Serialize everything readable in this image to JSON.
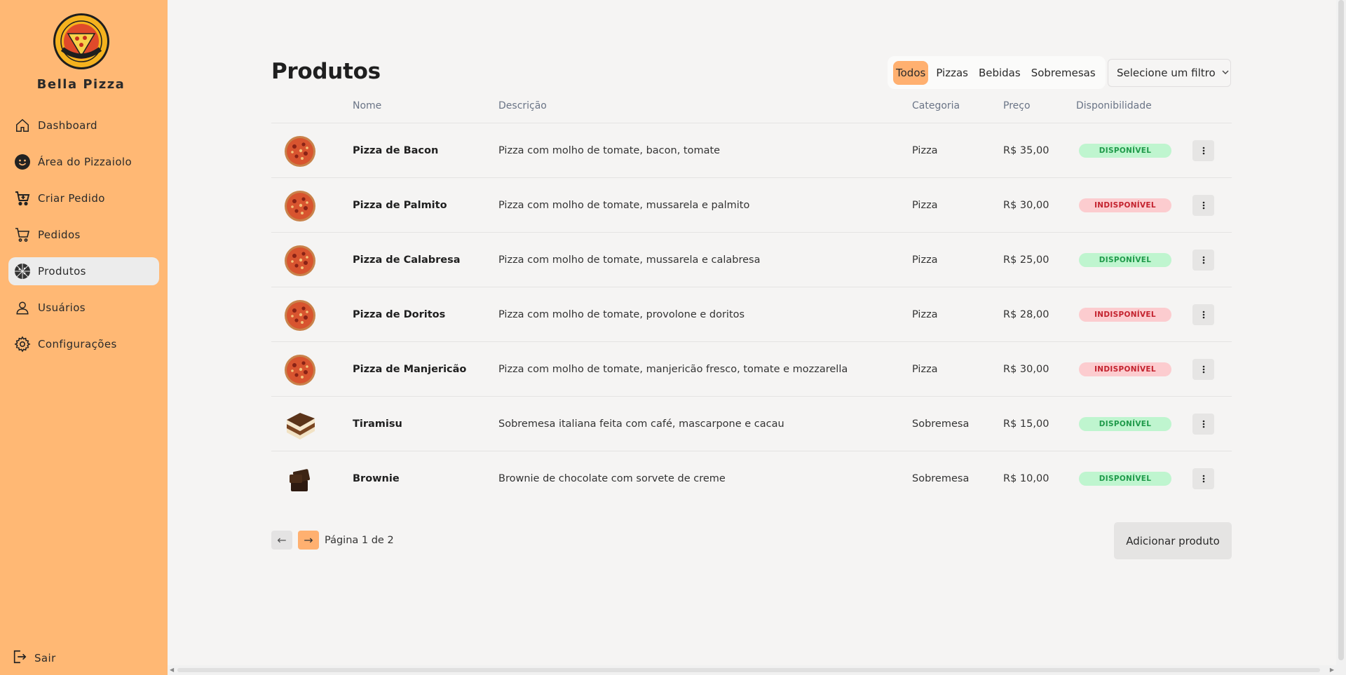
{
  "sidebar": {
    "brand": "Bella Pizza",
    "items": [
      {
        "label": "Dashboard",
        "icon": "home-icon",
        "active": false
      },
      {
        "label": "Área do Pizzaiolo",
        "icon": "smiley-icon",
        "active": false
      },
      {
        "label": "Criar Pedido",
        "icon": "cart-plus-icon",
        "active": false
      },
      {
        "label": "Pedidos",
        "icon": "cart-icon",
        "active": false
      },
      {
        "label": "Produtos",
        "icon": "pizza-icon",
        "active": true
      },
      {
        "label": "Usuários",
        "icon": "user-icon",
        "active": false
      },
      {
        "label": "Configurações",
        "icon": "gear-icon",
        "active": false
      }
    ],
    "logout_label": "Sair"
  },
  "main": {
    "title": "Produtos",
    "segments": [
      "Todos",
      "Pizzas",
      "Bebidas",
      "Sobremesas"
    ],
    "active_segment": "Todos",
    "filter_placeholder": "Selecione um filtro",
    "columns": [
      "Nome",
      "Descrição",
      "Categoria",
      "Preço",
      "Disponibilidade"
    ],
    "rows": [
      {
        "name": "Pizza de Bacon",
        "description": "Pizza com molho de tomate, bacon, tomate",
        "category": "Pizza",
        "price": "R$ 35,00",
        "status": "DISPONÍVEL",
        "available": true,
        "image": "pizza"
      },
      {
        "name": "Pizza de Palmito",
        "description": "Pizza com molho de tomate, mussarela e palmito",
        "category": "Pizza",
        "price": "R$ 30,00",
        "status": "INDISPONÍVEL",
        "available": false,
        "image": "pizza"
      },
      {
        "name": "Pizza de Calabresa",
        "description": "Pizza com molho de tomate, mussarela e calabresa",
        "category": "Pizza",
        "price": "R$ 25,00",
        "status": "DISPONÍVEL",
        "available": true,
        "image": "pizza"
      },
      {
        "name": "Pizza de Doritos",
        "description": "Pizza com molho de tomate, provolone e doritos",
        "category": "Pizza",
        "price": "R$ 28,00",
        "status": "INDISPONÍVEL",
        "available": false,
        "image": "pizza"
      },
      {
        "name": "Pizza de Manjericão",
        "description": "Pizza com molho de tomate, manjericão fresco, tomate e mozzarella",
        "category": "Pizza",
        "price": "R$ 30,00",
        "status": "INDISPONÍVEL",
        "available": false,
        "image": "pizza"
      },
      {
        "name": "Tiramisu",
        "description": "Sobremesa italiana feita com café, mascarpone e cacau",
        "category": "Sobremesa",
        "price": "R$ 15,00",
        "status": "DISPONÍVEL",
        "available": true,
        "image": "tiramisu"
      },
      {
        "name": "Brownie",
        "description": "Brownie de chocolate com sorvete de creme",
        "category": "Sobremesa",
        "price": "R$ 10,00",
        "status": "DISPONÍVEL",
        "available": true,
        "image": "brownie"
      }
    ],
    "pagination": {
      "prev": "←",
      "next": "→",
      "text": "Página 1 de 2"
    },
    "add_button": "Adicionar produto"
  },
  "colors": {
    "sidebar": "#ffb874",
    "accent": "#ffb070",
    "available_bg": "#bff5cf",
    "available_fg": "#1f9a4a",
    "unavailable_bg": "#fccccf",
    "unavailable_fg": "#c3222e"
  }
}
